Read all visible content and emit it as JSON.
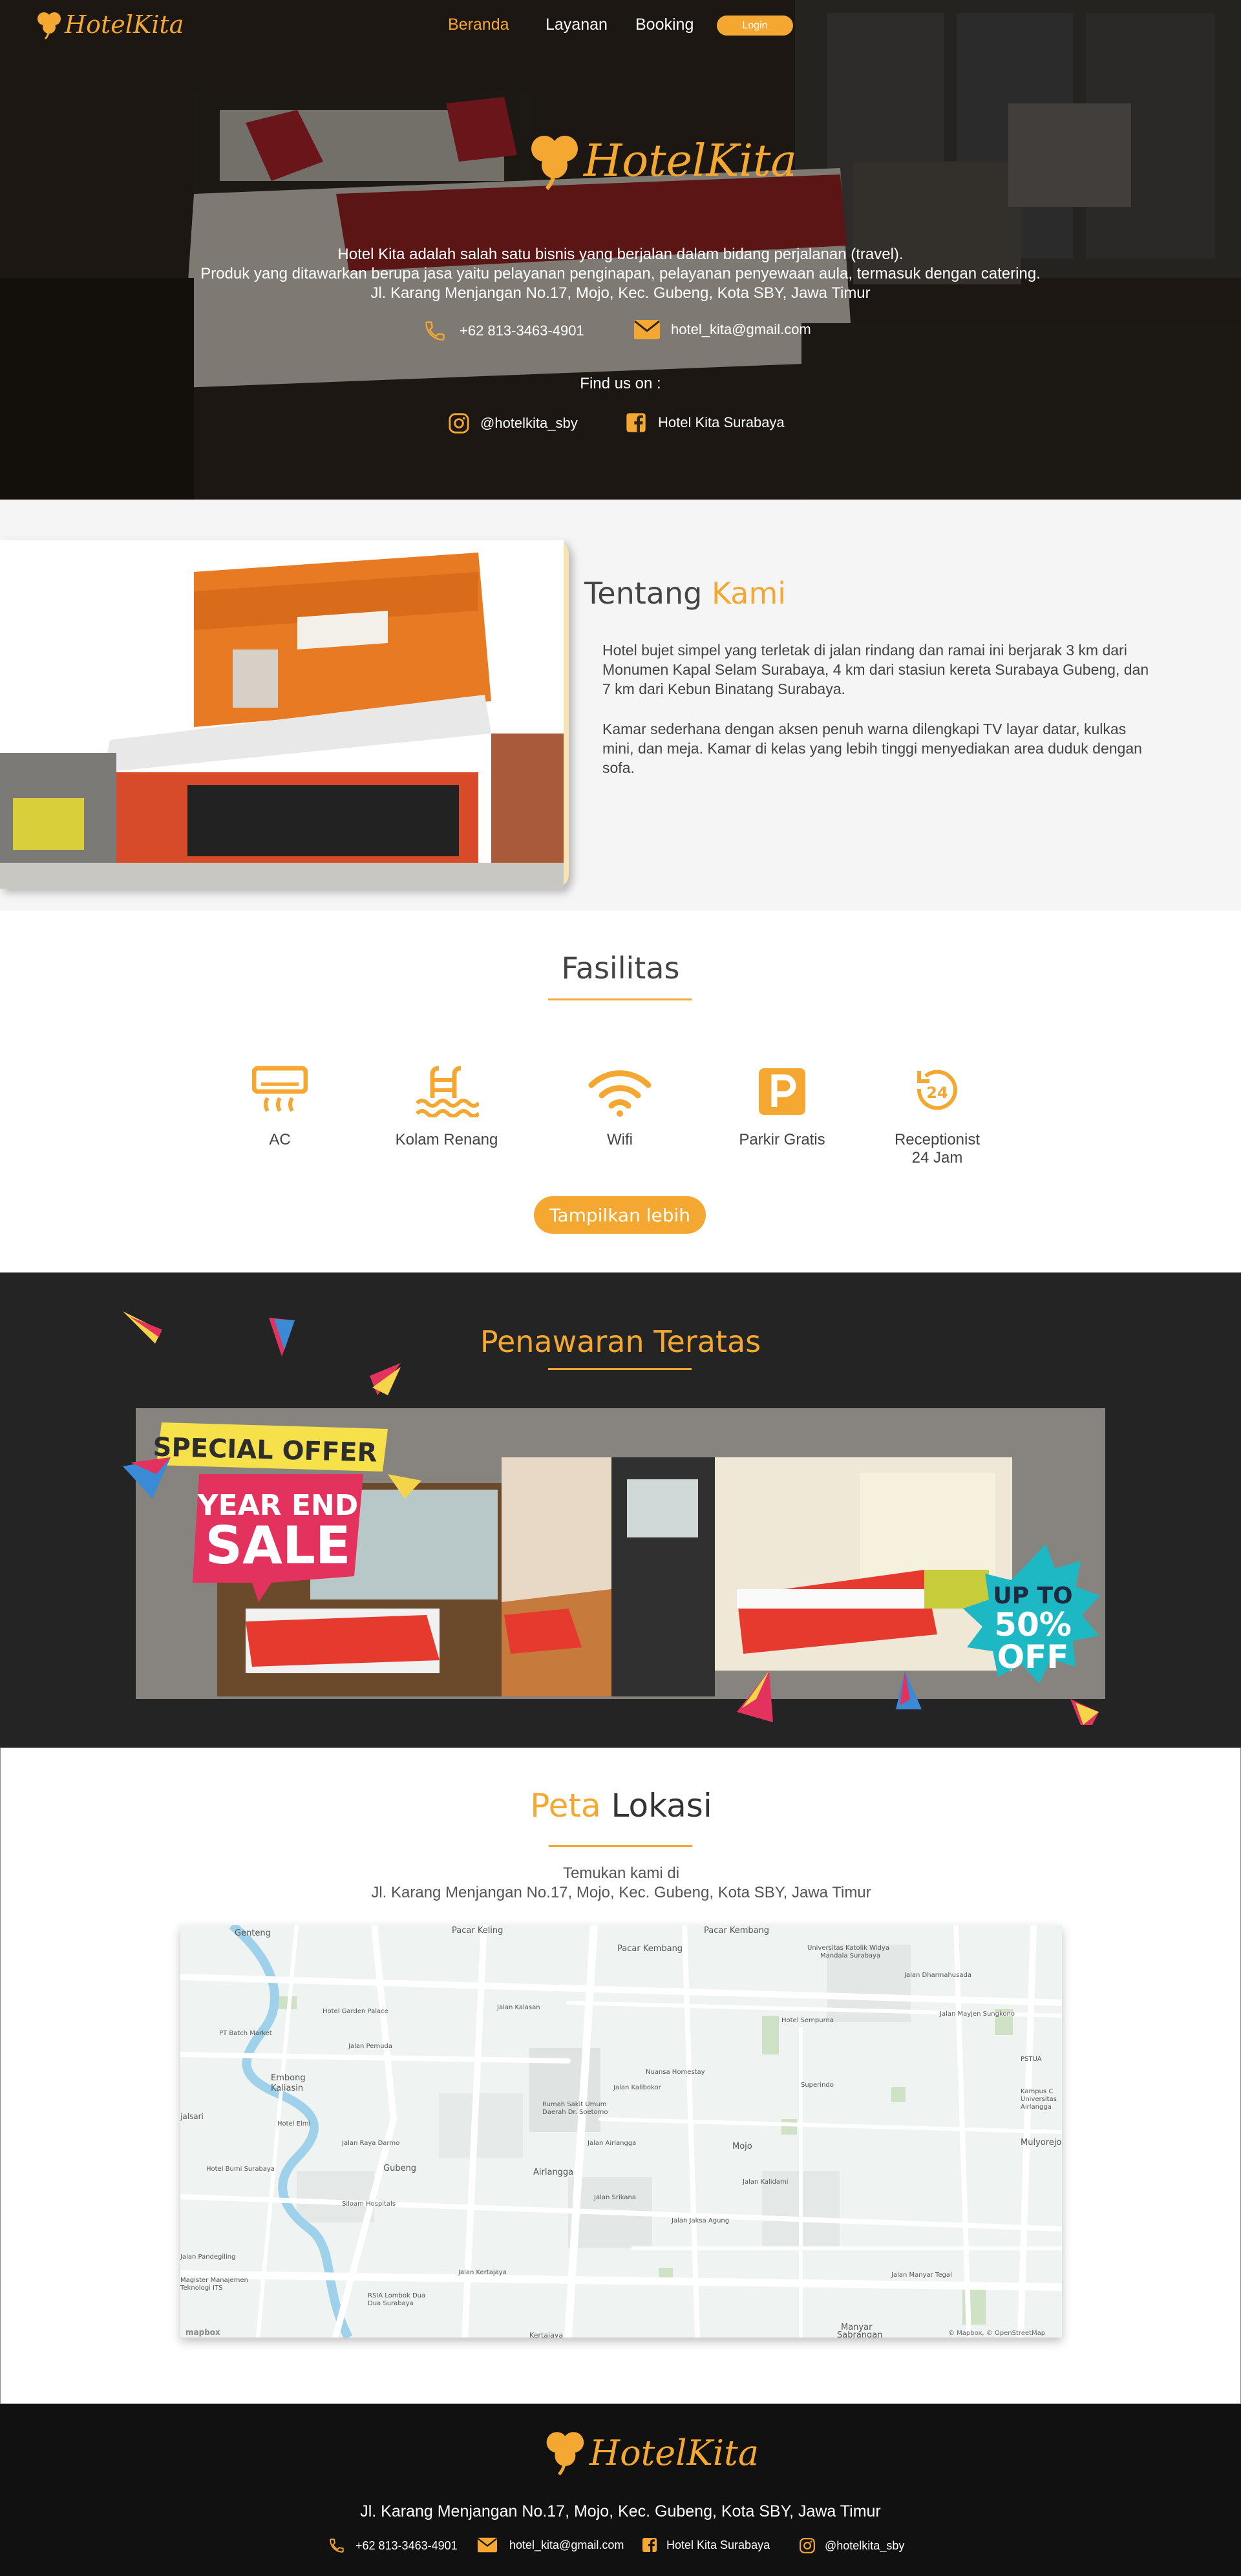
{
  "colors": {
    "accent": "#f4a831",
    "dark": "#242424",
    "footer": "#111111"
  },
  "brand": {
    "logo": "HotelKita"
  },
  "nav": {
    "items": [
      {
        "label": "Beranda",
        "active": true
      },
      {
        "label": "Layanan"
      },
      {
        "label": "Booking"
      }
    ],
    "login_label": "Login"
  },
  "hero": {
    "logo": "HotelKita",
    "desc_line1": "Hotel Kita adalah salah satu bisnis yang berjalan dalam bidang perjalanan (travel).",
    "desc_line2": "Produk yang ditawarkan berupa jasa yaitu pelayanan penginapan, pelayanan penyewaan aula, termasuk dengan catering.",
    "address": "Jl. Karang Menjangan No.17, Mojo, Kec. Gubeng, Kota SBY, Jawa Timur",
    "phone": "+62 813-3463-4901",
    "email": "hotel_kita@gmail.com",
    "find_us": "Find us on :",
    "instagram": "@hotelkita_sby",
    "facebook": "Hotel Kita Surabaya"
  },
  "about": {
    "title_a": "Tentang",
    "title_b": "Kami",
    "para1": "Hotel bujet simpel yang terletak di jalan rindang dan ramai ini berjarak 3 km dari Monumen Kapal Selam Surabaya, 4 km dari stasiun kereta Surabaya Gubeng, dan 7 km dari Kebun Binatang Surabaya.",
    "para2": "Kamar sederhana dengan aksen penuh warna dilengkapi TV layar datar, kulkas mini, dan meja. Kamar di kelas yang lebih tinggi menyediakan area duduk dengan sofa."
  },
  "facilities": {
    "title": "Fasilitas",
    "items": [
      {
        "label": "AC",
        "icon": "ac-icon"
      },
      {
        "label": "Kolam Renang",
        "icon": "pool-icon"
      },
      {
        "label": "Wifi",
        "icon": "wifi-icon"
      },
      {
        "label": "Parkir Gratis",
        "icon": "parking-icon"
      },
      {
        "label": "Receptionist",
        "label2": "24 Jam",
        "icon": "clock-24-icon"
      }
    ],
    "more_label": "Tampilkan lebih"
  },
  "offer": {
    "title": "Penawaran Teratas",
    "special": "SPECIAL OFFER",
    "year_end": "YEAR END",
    "sale": "SALE",
    "up_to": "UP TO",
    "percent": "50%",
    "off": "OFF"
  },
  "map": {
    "title_a": "Peta",
    "title_b": "Lokasi",
    "sub1": "Temukan kami di",
    "sub2": "Jl. Karang Menjangan No.17, Mojo, Kec. Gubeng, Kota SBY, Jawa Timur",
    "labels": [
      "Genteng",
      "Pacar Keling",
      "Pacar Kembang",
      "Pacar Kembang",
      "Universitas Katolik Widya Mandala Surabaya",
      "Hotel Garden Palace",
      "Jalan Kalasan",
      "Embong Kaliasin",
      "Jalan Pemuda",
      "Hotel Sempurna",
      "Rumah Sakit Umum Daerah Dr. Soetomo",
      "Hotel Elmi",
      "Nuansa Homestay",
      "Superindo",
      "Gubeng",
      "Airlangga",
      "Mojo",
      "Jalan Mayjen Sungkono",
      "Jalan Kertajaya",
      "Jalan Manyar Tegal",
      "Manyar Sabrangan",
      "Magister Manajemen Teknologi ITS",
      "RSIA Lombok Dua Dua Surabaya",
      "Kertajaya",
      "Mulyorejo",
      "Kampus C Universitas Airlangga",
      "Jalan Pandegiling",
      "Jalan Dharmahusada",
      "jalsari",
      "Hotel Bumi Surabaya",
      "Siloam Hospitals",
      "Jalan Raya Darmo",
      "PT Batch Market",
      "Jalan Kalibokor",
      "Jalan Airlangga",
      "Jalan Srikana",
      "PSTUA",
      "Jalan Kalidami",
      "Jalan Jaksa Agung"
    ],
    "attribution": "© Mapbox, © OpenStreetMap",
    "mapbox": "mapbox"
  },
  "footer": {
    "logo": "HotelKita",
    "address": "Jl. Karang Menjangan No.17, Mojo, Kec. Gubeng, Kota SBY, Jawa Timur",
    "phone": "+62 813-3463-4901",
    "email": "hotel_kita@gmail.com",
    "facebook": "Hotel Kita Surabaya",
    "instagram": "@hotelkita_sby"
  }
}
